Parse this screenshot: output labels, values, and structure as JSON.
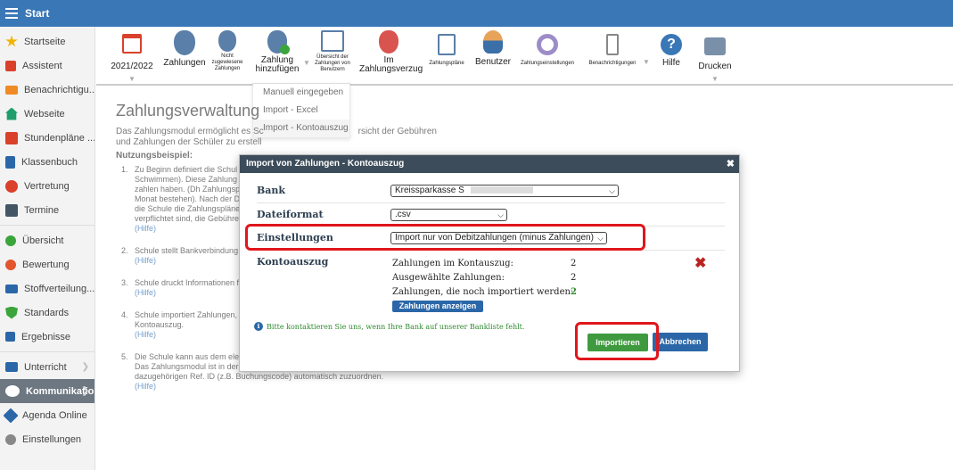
{
  "header": {
    "title": "Start"
  },
  "sidebar": {
    "items": [
      {
        "label": "Startseite",
        "icon": "star-icon",
        "color": "#f0b400"
      },
      {
        "label": "Assistent",
        "icon": "wand-icon",
        "color": "#d9412b"
      },
      {
        "label": "Benachrichtigu...",
        "icon": "mail-icon",
        "color": "#f08a24"
      },
      {
        "label": "Webseite",
        "icon": "home-icon",
        "color": "#1f9d6b"
      },
      {
        "label": "Stundenpläne ...",
        "icon": "calendar-icon",
        "color": "#d9412b"
      },
      {
        "label": "Klassenbuch",
        "icon": "book-icon",
        "color": "#2b67a8"
      },
      {
        "label": "Vertretung",
        "icon": "person-icon",
        "color": "#d9412b"
      },
      {
        "label": "Termine",
        "icon": "calendar-dark-icon",
        "color": "#445566"
      },
      {
        "label": "Übersicht",
        "icon": "check-circle-icon",
        "color": "#3aa53a"
      },
      {
        "label": "Bewertung",
        "icon": "badge-icon",
        "color": "#e2552d"
      },
      {
        "label": "Stoffverteilung...",
        "icon": "layers-icon",
        "color": "#2b67a8"
      },
      {
        "label": "Standards",
        "icon": "shield-icon",
        "color": "#3aa53a"
      },
      {
        "label": "Ergebnisse",
        "icon": "bar-chart-icon",
        "color": "#2b67a8"
      },
      {
        "label": "Unterricht",
        "icon": "briefcase-icon",
        "color": "#2b67a8"
      },
      {
        "label": "Kommunikation",
        "icon": "chat-icon",
        "color": "#ffffff"
      },
      {
        "label": "Agenda Online",
        "icon": "pen-icon",
        "color": "#2b67a8"
      },
      {
        "label": "Einstellungen",
        "icon": "gear-icon",
        "color": "#888888"
      }
    ]
  },
  "toolbar": {
    "year": "2021/2022",
    "zahlungen": "Zahlungen",
    "nicht_zugewiesen": [
      "Nicht",
      "zugewiesene",
      "Zahlungen"
    ],
    "zahlung_hinzufuegen": [
      "Zahlung",
      "hinzufügen"
    ],
    "uebersicht": [
      "Übersicht der",
      "Zahlungen von",
      "Benutzern"
    ],
    "im_verzug": [
      "Im",
      "Zahlungsverzug"
    ],
    "zahlungsplaene": "Zahlungspläne",
    "benutzer": "Benutzer",
    "zahlungseinstellungen": "Zahlungseinstellungen",
    "benachrichtigungen": "Benachrichtigungen",
    "hilfe": "Hilfe",
    "drucken": "Drucken"
  },
  "dropdown": {
    "items": [
      "Manuell eingegeben",
      "Import - Excel",
      "Import - Kontoauszug"
    ]
  },
  "page": {
    "title": "Zahlungsverwaltung",
    "intro": "Das Zahlungsmodul ermöglicht es Sc... Übersicht der Gebühren und Zahlungen der Schüler zu erstellen.",
    "intro_a": "Das Zahlungsmodul ermöglicht es Sc",
    "intro_b": "rsicht der Gebühren",
    "intro_c": "und Zahlungen der Schüler zu erstell",
    "usage": "Nutzungsbeispiel:",
    "steps": [
      {
        "n": "1.",
        "text": "Zu Beginn definiert die Schul\nSchwimmen). Diese Zahlung\nzahlen haben. (Dh Zahlungsp\nMonat bestehen). Nach der D\ndie Schule die Zahlungspläne\nverpflichtet sind, die Gebühre",
        "help": "(Hilfe)"
      },
      {
        "n": "2.",
        "text": "Schule stellt Bankverbindung",
        "help": "(Hilfe)"
      },
      {
        "n": "3.",
        "text": "Schule druckt Informationen f",
        "help": "(Hilfe)"
      },
      {
        "n": "4.",
        "text": "Schule importiert Zahlungen,\nKontoauszug.",
        "help": "(Hilfe)"
      },
      {
        "n": "5.",
        "text": "Die Schule kann aus dem ele\nDas Zahlungsmodul ist in der\ndazugehörigen Ref. ID (z.B. Buchungscode) automatisch zuzuordnen.",
        "help": "(Hilfe)"
      }
    ]
  },
  "modal": {
    "title": "Import von Zahlungen - Kontoauszug",
    "bank_label": "Bank",
    "bank_value": "Kreissparkasse S",
    "format_label": "Dateiformat",
    "format_value": ".csv",
    "settings_label": "Einstellungen",
    "settings_value": "Import nur von Debitzahlungen (minus Zahlungen)",
    "statement_label": "Kontoauszug",
    "stats": [
      {
        "label": "Zahlungen im Kontauszug:",
        "value": "2"
      },
      {
        "label": "Ausgewählte Zahlungen:",
        "value": "2"
      },
      {
        "label": "Zahlungen, die noch importiert werden:",
        "value": "2"
      }
    ],
    "show_button": "Zahlungen anzeigen",
    "info": "Bitte kontaktieren Sie uns, wenn Ihre Bank auf unserer Bankliste fehlt.",
    "import_button": "Importieren",
    "cancel_button": "Abbrechen"
  },
  "colors": {
    "header_bg": "#3a77b6",
    "modal_head": "#3c4c5a",
    "primary": "#2b67a8",
    "success": "#3f9a3f",
    "highlight": "#e0161c"
  }
}
